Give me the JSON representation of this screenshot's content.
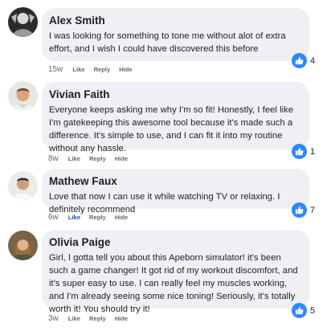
{
  "colors": {
    "bubble": "#eef0f3",
    "like_blue": "#2d88ff",
    "meta": "#65676b"
  },
  "actions": {
    "like": "Like",
    "reply": "Reply",
    "hide": "Hide"
  },
  "comments": [
    {
      "name": "Alex Smith",
      "text": "I was looking for something to tone me without alot of extra effort, and I wish I could have discovered this before",
      "time": "15w",
      "likes": "4"
    },
    {
      "name": "Vivian Faith",
      "text": "Everyone keeps asking me why I'm so fit! Honestly, I feel like I'm gatekeeping this awesome tool because it's made such a difference. It's simple to use, and I can fit it into my routine without any hassle.",
      "time": "8w",
      "likes": "1"
    },
    {
      "name": "Mathew Faux",
      "text": "Love that now I can use it while watching TV or relaxing. I definitely recommend",
      "time": "6w",
      "likes": "7"
    },
    {
      "name": "Olivia Paige",
      "text": "Girl, I gotta tell you about this Apeborn simulator! it's been such a game changer! It got rid of my workout discomfort, and it's super easy to use. I can really feel my muscles working, and I'm already seeing some nice toning! Seriously, it's totally worth it! You should try it!",
      "time": "3w",
      "likes": "5"
    }
  ]
}
